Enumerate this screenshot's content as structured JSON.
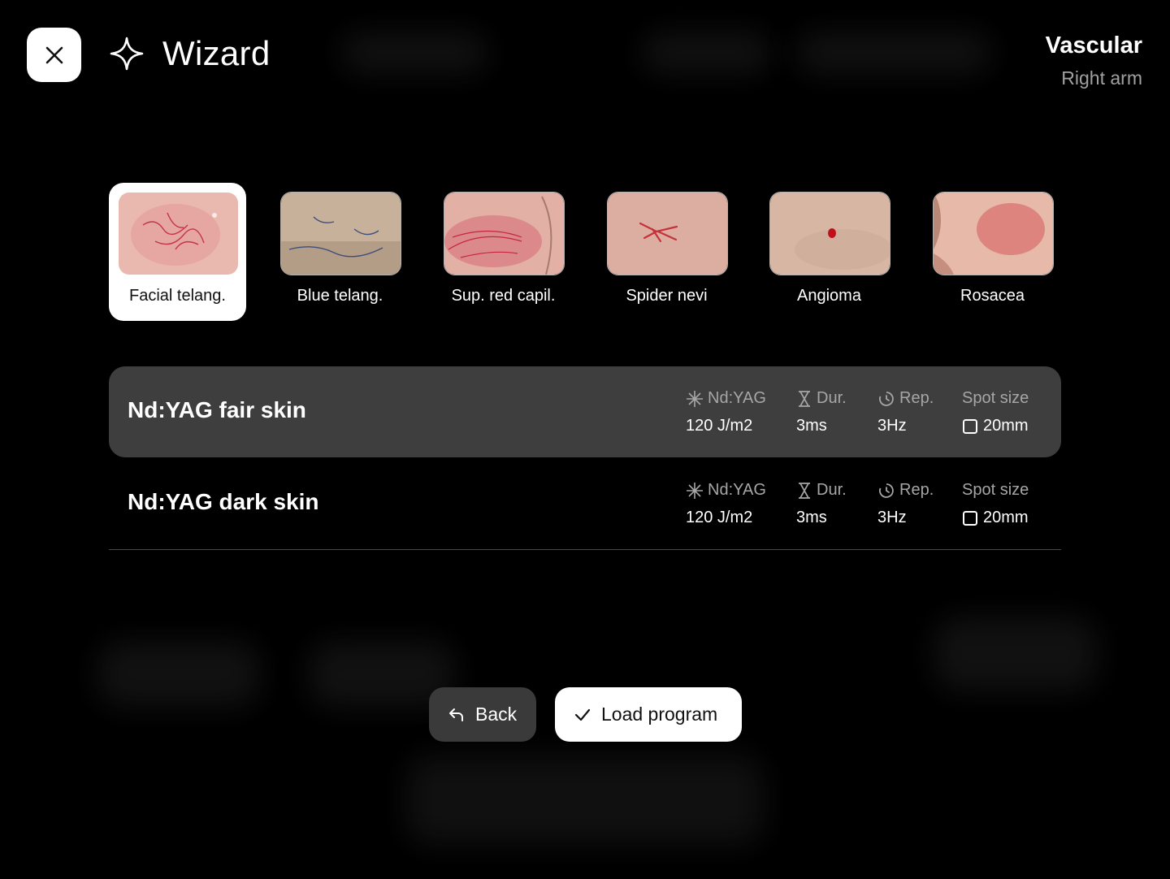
{
  "header": {
    "title": "Wizard",
    "treatment_area": "Vascular",
    "body_site": "Right arm"
  },
  "indications": [
    {
      "label": "Facial telang.",
      "selected": true
    },
    {
      "label": "Blue telang.",
      "selected": false
    },
    {
      "label": "Sup. red capil.",
      "selected": false
    },
    {
      "label": "Spider nevi",
      "selected": false
    },
    {
      "label": "Angioma",
      "selected": false
    },
    {
      "label": "Rosacea",
      "selected": false
    }
  ],
  "programs": [
    {
      "name": "Nd:YAG fair skin",
      "active": true,
      "params": [
        {
          "key": "Nd:YAG",
          "value": "120 J/m2",
          "icon": "laser-star-icon"
        },
        {
          "key": "Dur.",
          "value": "3ms",
          "icon": "hourglass-icon"
        },
        {
          "key": "Rep.",
          "value": "3Hz",
          "icon": "repeat-clock-icon"
        },
        {
          "key": "Spot size",
          "value": "20mm",
          "icon": "square-spot-icon"
        }
      ]
    },
    {
      "name": "Nd:YAG dark skin",
      "active": false,
      "params": [
        {
          "key": "Nd:YAG",
          "value": "120 J/m2",
          "icon": "laser-star-icon"
        },
        {
          "key": "Dur.",
          "value": "3ms",
          "icon": "hourglass-icon"
        },
        {
          "key": "Rep.",
          "value": "3Hz",
          "icon": "repeat-clock-icon"
        },
        {
          "key": "Spot size",
          "value": "20mm",
          "icon": "square-spot-icon"
        }
      ]
    }
  ],
  "actions": {
    "back_label": "Back",
    "load_label": "Load program"
  },
  "colors": {
    "background": "#000000",
    "active_row": "#3e3e3e",
    "secondary_button": "#3a3a3a",
    "muted_text": "#a6a6a6"
  }
}
